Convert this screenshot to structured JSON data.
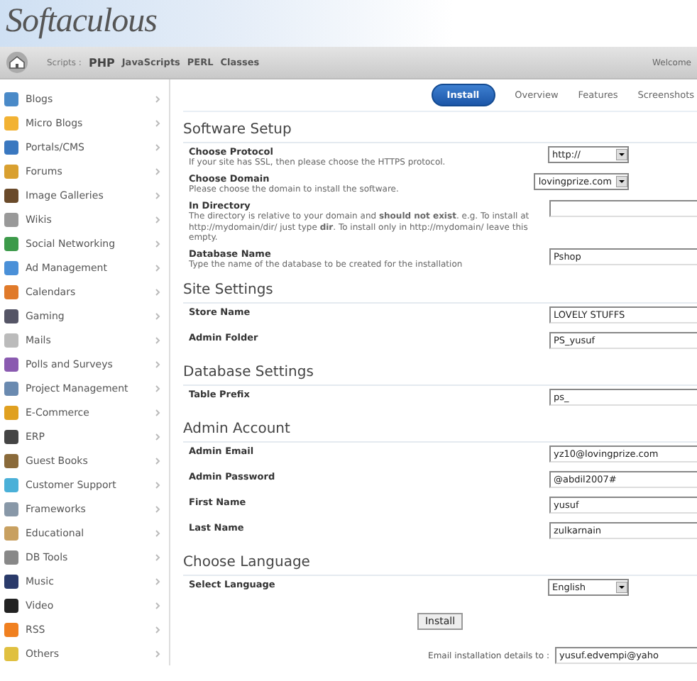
{
  "header": {
    "logo": "Softaculous"
  },
  "nav": {
    "label": "Scripts :",
    "links": [
      {
        "text": "PHP",
        "selected": true
      },
      {
        "text": "JavaScripts",
        "selected": false
      },
      {
        "text": "PERL",
        "selected": false
      },
      {
        "text": "Classes",
        "selected": false
      }
    ],
    "welcome": "Welcome"
  },
  "sidebar": {
    "items": [
      {
        "label": "Blogs"
      },
      {
        "label": "Micro Blogs"
      },
      {
        "label": "Portals/CMS"
      },
      {
        "label": "Forums"
      },
      {
        "label": "Image Galleries"
      },
      {
        "label": "Wikis"
      },
      {
        "label": "Social Networking"
      },
      {
        "label": "Ad Management"
      },
      {
        "label": "Calendars"
      },
      {
        "label": "Gaming"
      },
      {
        "label": "Mails"
      },
      {
        "label": "Polls and Surveys"
      },
      {
        "label": "Project Management"
      },
      {
        "label": "E-Commerce"
      },
      {
        "label": "ERP"
      },
      {
        "label": "Guest Books"
      },
      {
        "label": "Customer Support"
      },
      {
        "label": "Frameworks"
      },
      {
        "label": "Educational"
      },
      {
        "label": "DB Tools"
      },
      {
        "label": "Music"
      },
      {
        "label": "Video"
      },
      {
        "label": "RSS"
      },
      {
        "label": "Others"
      }
    ]
  },
  "tabs": [
    {
      "label": "Install",
      "selected": true
    },
    {
      "label": "Overview",
      "selected": false
    },
    {
      "label": "Features",
      "selected": false
    },
    {
      "label": "Screenshots",
      "selected": false
    }
  ],
  "sections": [
    {
      "title": "Software Setup",
      "fields": [
        {
          "label": "Choose Protocol",
          "description": "If your site has SSL, then please choose the HTTPS protocol.",
          "kind": "select",
          "value": "http://"
        },
        {
          "label": "Choose Domain",
          "description": "Please choose the domain to install the software.",
          "kind": "select",
          "value": "lovingprize.com"
        },
        {
          "label": "In Directory",
          "description": "The directory is relative to your domain and **should not exist**. e.g. To install at http://mydomain/dir/ just type **dir**. To install only in http://mydomain/ leave this empty.",
          "kind": "text"
        },
        {
          "label": "Database Name",
          "description": "Type the name of the database to be created for the installation",
          "kind": "text",
          "value": "Pshop"
        }
      ]
    },
    {
      "title": "Site Settings",
      "fields": [
        {
          "label": "Store Name",
          "kind": "text",
          "value": "LOVELY STUFFS"
        },
        {
          "label": "Admin Folder",
          "kind": "text",
          "value": "PS_yusuf"
        }
      ]
    },
    {
      "title": "Database Settings",
      "fields": [
        {
          "label": "Table Prefix",
          "kind": "text",
          "value": "ps_"
        }
      ]
    },
    {
      "title": "Admin Account",
      "fields": [
        {
          "label": "Admin Email",
          "kind": "text",
          "value": "yz10@lovingprize.com"
        },
        {
          "label": "Admin Password",
          "kind": "text",
          "value": "@abdil2007#"
        },
        {
          "label": "First Name",
          "kind": "text",
          "value": "yusuf"
        },
        {
          "label": "Last Name",
          "kind": "text",
          "value": "zulkarnain"
        }
      ]
    },
    {
      "title": "Choose Language",
      "fields": [
        {
          "label": "Select Language",
          "kind": "select",
          "value": "English"
        }
      ]
    }
  ],
  "install_button": "Install",
  "email": {
    "label": "Email installation details to :",
    "value": "yusuf.edvempi@yaho"
  }
}
